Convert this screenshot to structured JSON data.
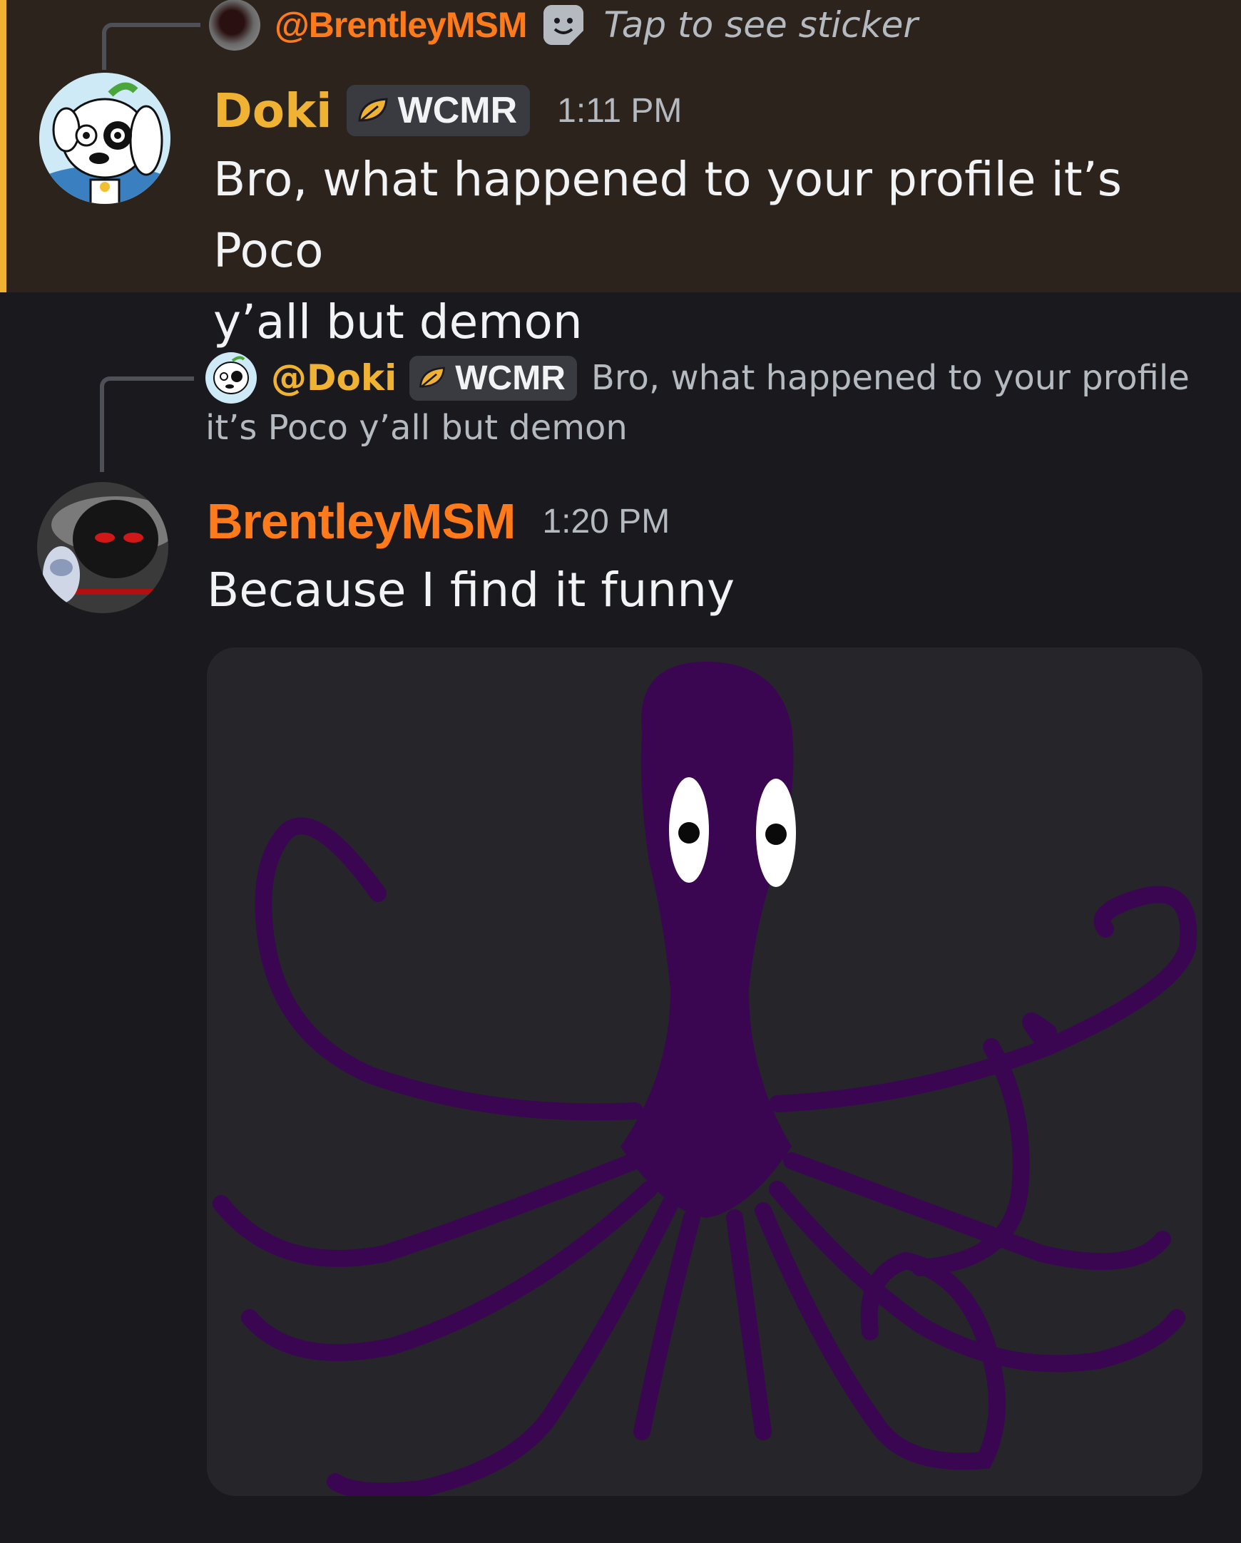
{
  "message1": {
    "reply": {
      "mention": "@BrentleyMSM",
      "sticker_icon": "sticker-icon",
      "text": "Tap to see sticker"
    },
    "author": "Doki",
    "tag": "WCMR",
    "time": "1:11 PM",
    "text_line1": "Bro, what happened to your profile it’s Poco",
    "text_line2": "y’all but demon"
  },
  "message2": {
    "reply": {
      "mention": "@Doki",
      "tag": "WCMR",
      "text_line1": "Bro, what happened to your profile",
      "text_line2": "it’s Poco y’all but demon"
    },
    "author": "BrentleyMSM",
    "time": "1:20 PM",
    "text": "Because I find it funny",
    "attachment": "octopus-image"
  },
  "colors": {
    "highlight_bar": "#f0b232",
    "doki_name": "#f0b232",
    "brentley_name": "#ff7a1a",
    "octopus": "#3a0652"
  }
}
